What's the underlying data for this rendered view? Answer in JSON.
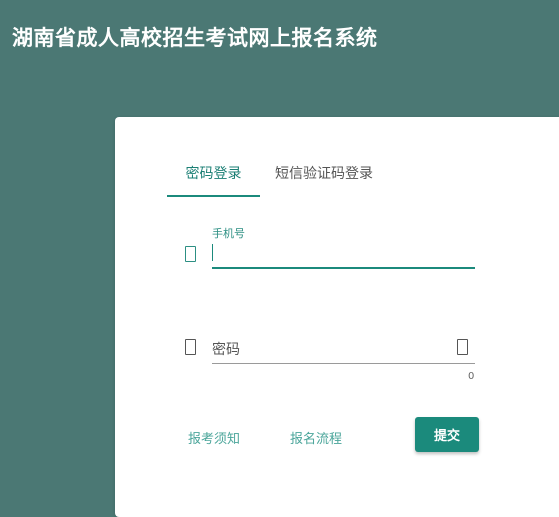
{
  "app": {
    "title": "湖南省成人高校招生考试网上报名系统"
  },
  "tabs": [
    {
      "label": "密码登录",
      "active": true
    },
    {
      "label": "短信验证码登录",
      "active": false
    }
  ],
  "phone": {
    "label": "手机号",
    "value": ""
  },
  "password": {
    "placeholder": "密码",
    "char_count": "0"
  },
  "links": {
    "exam_notice": "报考须知",
    "registration_process": "报名流程"
  },
  "submit": {
    "label": "提交"
  },
  "colors": {
    "background": "#4b7874",
    "accent": "#1b8a7c",
    "link": "#4aa59a"
  },
  "icons": {
    "phone_field": "phone-icon",
    "password_field": "lock-icon",
    "visibility": "eye-icon"
  }
}
